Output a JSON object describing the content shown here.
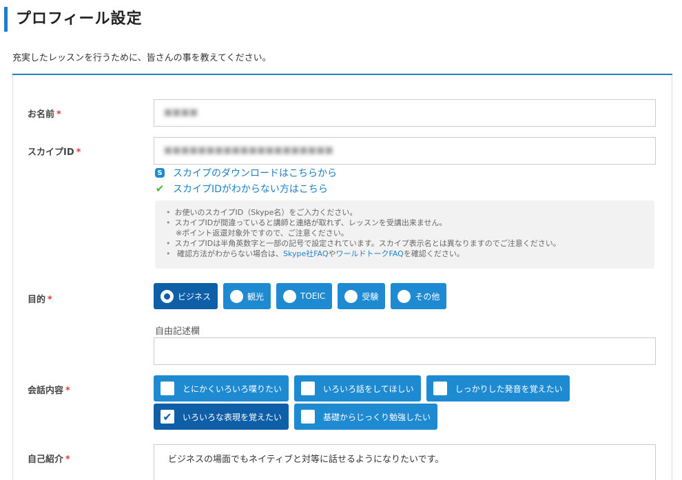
{
  "page": {
    "title": "プロフィール設定",
    "intro": "充実したレッスンを行うために、皆さんの事を教えてください。",
    "required_mark": "*"
  },
  "name_field": {
    "label": "お名前",
    "value": "■■■■"
  },
  "skype_field": {
    "label": "スカイプID",
    "value": "■■■■■■■■■■■■■■■■■■■■",
    "download_link": "スカイプのダウンロードはこちらから",
    "help_link": "スカイプIDがわからない方はこちら",
    "notes": [
      "お使いのスカイプID（Skype名）をご入力ください。",
      "スカイプIDが間違っていると講師と連絡が取れず、レッスンを受講出来ません。",
      "※ポイント返還対象外ですので、ご注意ください。",
      "スカイプIDは半角英数字と一部の記号で設定されています。スカイプ表示名とは異なりますのでご注意ください。"
    ],
    "last_note_prefix": "確認方法がわからない場合は、",
    "last_note_link1": "Skype社FAQ",
    "last_note_mid": "や",
    "last_note_link2": "ワールドトークFAQ",
    "last_note_suffix": "を確認ください。"
  },
  "purpose_field": {
    "label": "目的",
    "options": [
      "ビジネス",
      "観光",
      "TOEIC",
      "受験",
      "その他"
    ],
    "selected_index": 0,
    "free_text_label": "自由記述欄",
    "free_text_value": ""
  },
  "conversation_field": {
    "label": "会話内容",
    "options": [
      "とにかくいろいろ喋りたい",
      "いろいろ話をしてほしい",
      "しっかりした発音を覚えたい",
      "いろいろな表現を覚えたい",
      "基礎からじっくり勉強したい"
    ],
    "checked": [
      false,
      false,
      false,
      true,
      false
    ]
  },
  "intro_field": {
    "label": "自己紹介",
    "value": "ビジネスの場面でもネイティブと対等に話せるようになりたいです。"
  },
  "colors": {
    "accent": "#1e7fc8",
    "button": "#1e8ad2",
    "button_selected": "#0f5ea8",
    "required": "#e03a3a",
    "check": "#4ab53a"
  }
}
